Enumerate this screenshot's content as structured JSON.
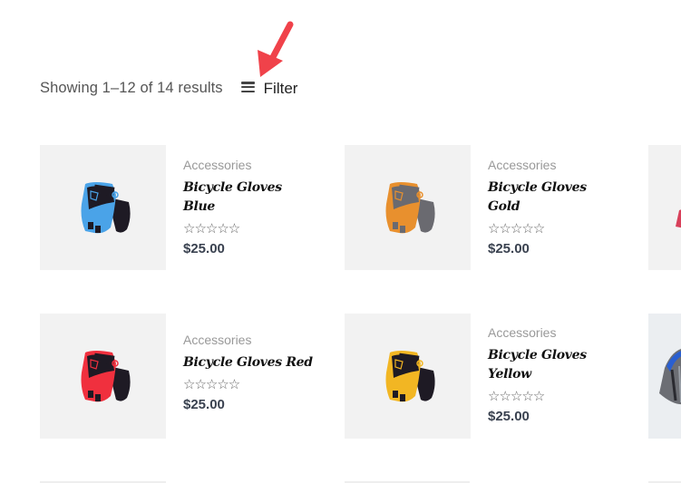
{
  "toolbar": {
    "result_count": "Showing 1–12 of 14 results",
    "filter_label": "Filter",
    "filter_icon": "hamburger-menu-icon"
  },
  "annotation": {
    "arrow_icon": "red-pointer-arrow-icon",
    "color": "#f0424a"
  },
  "products": [
    {
      "category": "Accessories",
      "title": "Bicycle Gloves Blue",
      "rating_stars": 0,
      "rating_max": 5,
      "price": "$25.00",
      "image": "blue-glove-image",
      "colors": {
        "main": "#4aa3e8",
        "dark": "#1e1a24"
      }
    },
    {
      "category": "Accessories",
      "title": "Bicycle Gloves Gold",
      "rating_stars": 0,
      "rating_max": 5,
      "price": "$25.00",
      "image": "gold-glove-image",
      "colors": {
        "main": "#e8902e",
        "dark": "#6a6a70"
      }
    },
    {
      "category": "Accessories",
      "title": "Bicycle Gloves Red",
      "rating_stars": 0,
      "rating_max": 5,
      "price": "$25.00",
      "image": "red-glove-image",
      "colors": {
        "main": "#f0303e",
        "dark": "#1e1a24"
      }
    },
    {
      "category": "Accessories",
      "title": "Bicycle Gloves Yellow",
      "rating_stars": 0,
      "rating_max": 5,
      "price": "$25.00",
      "image": "yellow-glove-image",
      "colors": {
        "main": "#f2b623",
        "dark": "#1e1a24"
      }
    }
  ],
  "partial_products": [
    {
      "image": "red-product-partial-image"
    },
    {
      "image": "helmet-partial-image"
    }
  ],
  "stars_text": "☆☆☆☆☆"
}
